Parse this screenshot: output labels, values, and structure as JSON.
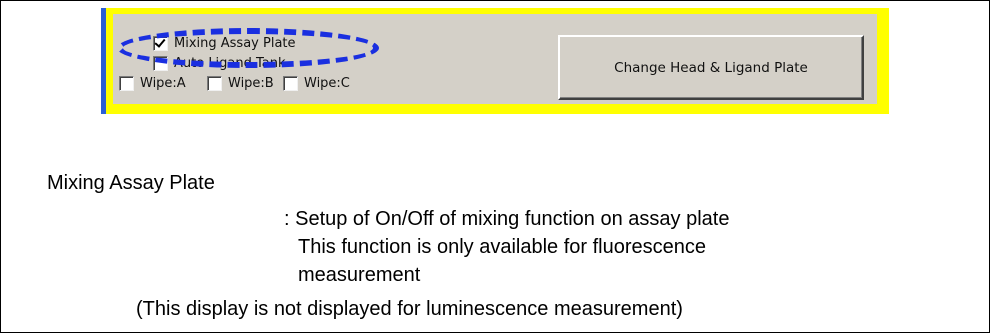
{
  "screenshot": {
    "options": {
      "mixing_assay_plate": {
        "label": "Mixing Assay Plate",
        "checked": true
      },
      "auto_ligand_tank": {
        "label": "Auto Ligand Tank",
        "checked": false
      },
      "wipe_a": {
        "label": "Wipe:A",
        "checked": false
      },
      "wipe_b": {
        "label": "Wipe:B",
        "checked": false
      },
      "wipe_c": {
        "label": "Wipe:C",
        "checked": false
      }
    },
    "change_button_label": "Change Head & Ligand Plate"
  },
  "colors": {
    "highlight": "#1a2fe0",
    "panel_border": "#ffff00",
    "panel_accent": "#2a5fd6",
    "panel_bg": "#d4d0c8"
  },
  "description": {
    "heading": "Mixing Assay Plate",
    "line1": ": Setup of On/Off of mixing function on assay plate",
    "line2": "This function is only available for fluorescence",
    "line3": "measurement",
    "note": "(This display is not displayed for luminescence measurement)"
  }
}
